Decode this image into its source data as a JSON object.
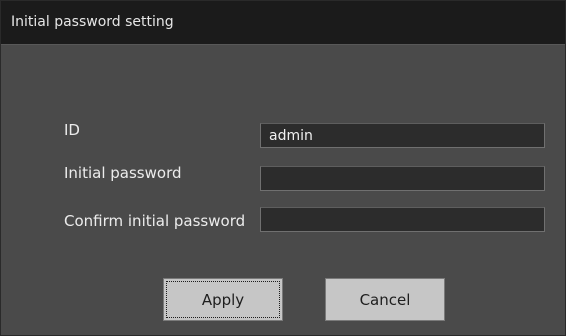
{
  "window": {
    "title": "Initial password setting"
  },
  "form": {
    "fields": [
      {
        "label": "ID",
        "value": "admin"
      },
      {
        "label": "Initial password",
        "value": ""
      },
      {
        "label": "Confirm initial password",
        "value": ""
      }
    ]
  },
  "buttons": {
    "apply_label": "Apply",
    "cancel_label": "Cancel"
  },
  "colors": {
    "titlebar": "#1b1b1b",
    "body": "#4a4a4a",
    "input_bg": "#2c2c2c",
    "button_bg": "#c6c6c6"
  }
}
